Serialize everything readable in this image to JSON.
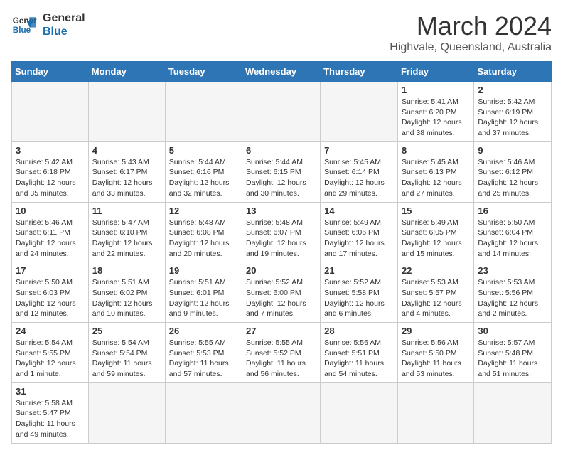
{
  "header": {
    "logo_line1": "General",
    "logo_line2": "Blue",
    "title": "March 2024",
    "subtitle": "Highvale, Queensland, Australia"
  },
  "weekdays": [
    "Sunday",
    "Monday",
    "Tuesday",
    "Wednesday",
    "Thursday",
    "Friday",
    "Saturday"
  ],
  "weeks": [
    [
      {
        "day": "",
        "info": ""
      },
      {
        "day": "",
        "info": ""
      },
      {
        "day": "",
        "info": ""
      },
      {
        "day": "",
        "info": ""
      },
      {
        "day": "",
        "info": ""
      },
      {
        "day": "1",
        "info": "Sunrise: 5:41 AM\nSunset: 6:20 PM\nDaylight: 12 hours and 38 minutes."
      },
      {
        "day": "2",
        "info": "Sunrise: 5:42 AM\nSunset: 6:19 PM\nDaylight: 12 hours and 37 minutes."
      }
    ],
    [
      {
        "day": "3",
        "info": "Sunrise: 5:42 AM\nSunset: 6:18 PM\nDaylight: 12 hours and 35 minutes."
      },
      {
        "day": "4",
        "info": "Sunrise: 5:43 AM\nSunset: 6:17 PM\nDaylight: 12 hours and 33 minutes."
      },
      {
        "day": "5",
        "info": "Sunrise: 5:44 AM\nSunset: 6:16 PM\nDaylight: 12 hours and 32 minutes."
      },
      {
        "day": "6",
        "info": "Sunrise: 5:44 AM\nSunset: 6:15 PM\nDaylight: 12 hours and 30 minutes."
      },
      {
        "day": "7",
        "info": "Sunrise: 5:45 AM\nSunset: 6:14 PM\nDaylight: 12 hours and 29 minutes."
      },
      {
        "day": "8",
        "info": "Sunrise: 5:45 AM\nSunset: 6:13 PM\nDaylight: 12 hours and 27 minutes."
      },
      {
        "day": "9",
        "info": "Sunrise: 5:46 AM\nSunset: 6:12 PM\nDaylight: 12 hours and 25 minutes."
      }
    ],
    [
      {
        "day": "10",
        "info": "Sunrise: 5:46 AM\nSunset: 6:11 PM\nDaylight: 12 hours and 24 minutes."
      },
      {
        "day": "11",
        "info": "Sunrise: 5:47 AM\nSunset: 6:10 PM\nDaylight: 12 hours and 22 minutes."
      },
      {
        "day": "12",
        "info": "Sunrise: 5:48 AM\nSunset: 6:08 PM\nDaylight: 12 hours and 20 minutes."
      },
      {
        "day": "13",
        "info": "Sunrise: 5:48 AM\nSunset: 6:07 PM\nDaylight: 12 hours and 19 minutes."
      },
      {
        "day": "14",
        "info": "Sunrise: 5:49 AM\nSunset: 6:06 PM\nDaylight: 12 hours and 17 minutes."
      },
      {
        "day": "15",
        "info": "Sunrise: 5:49 AM\nSunset: 6:05 PM\nDaylight: 12 hours and 15 minutes."
      },
      {
        "day": "16",
        "info": "Sunrise: 5:50 AM\nSunset: 6:04 PM\nDaylight: 12 hours and 14 minutes."
      }
    ],
    [
      {
        "day": "17",
        "info": "Sunrise: 5:50 AM\nSunset: 6:03 PM\nDaylight: 12 hours and 12 minutes."
      },
      {
        "day": "18",
        "info": "Sunrise: 5:51 AM\nSunset: 6:02 PM\nDaylight: 12 hours and 10 minutes."
      },
      {
        "day": "19",
        "info": "Sunrise: 5:51 AM\nSunset: 6:01 PM\nDaylight: 12 hours and 9 minutes."
      },
      {
        "day": "20",
        "info": "Sunrise: 5:52 AM\nSunset: 6:00 PM\nDaylight: 12 hours and 7 minutes."
      },
      {
        "day": "21",
        "info": "Sunrise: 5:52 AM\nSunset: 5:58 PM\nDaylight: 12 hours and 6 minutes."
      },
      {
        "day": "22",
        "info": "Sunrise: 5:53 AM\nSunset: 5:57 PM\nDaylight: 12 hours and 4 minutes."
      },
      {
        "day": "23",
        "info": "Sunrise: 5:53 AM\nSunset: 5:56 PM\nDaylight: 12 hours and 2 minutes."
      }
    ],
    [
      {
        "day": "24",
        "info": "Sunrise: 5:54 AM\nSunset: 5:55 PM\nDaylight: 12 hours and 1 minute."
      },
      {
        "day": "25",
        "info": "Sunrise: 5:54 AM\nSunset: 5:54 PM\nDaylight: 11 hours and 59 minutes."
      },
      {
        "day": "26",
        "info": "Sunrise: 5:55 AM\nSunset: 5:53 PM\nDaylight: 11 hours and 57 minutes."
      },
      {
        "day": "27",
        "info": "Sunrise: 5:55 AM\nSunset: 5:52 PM\nDaylight: 11 hours and 56 minutes."
      },
      {
        "day": "28",
        "info": "Sunrise: 5:56 AM\nSunset: 5:51 PM\nDaylight: 11 hours and 54 minutes."
      },
      {
        "day": "29",
        "info": "Sunrise: 5:56 AM\nSunset: 5:50 PM\nDaylight: 11 hours and 53 minutes."
      },
      {
        "day": "30",
        "info": "Sunrise: 5:57 AM\nSunset: 5:48 PM\nDaylight: 11 hours and 51 minutes."
      }
    ],
    [
      {
        "day": "31",
        "info": "Sunrise: 5:58 AM\nSunset: 5:47 PM\nDaylight: 11 hours and 49 minutes."
      },
      {
        "day": "",
        "info": ""
      },
      {
        "day": "",
        "info": ""
      },
      {
        "day": "",
        "info": ""
      },
      {
        "day": "",
        "info": ""
      },
      {
        "day": "",
        "info": ""
      },
      {
        "day": "",
        "info": ""
      }
    ]
  ]
}
